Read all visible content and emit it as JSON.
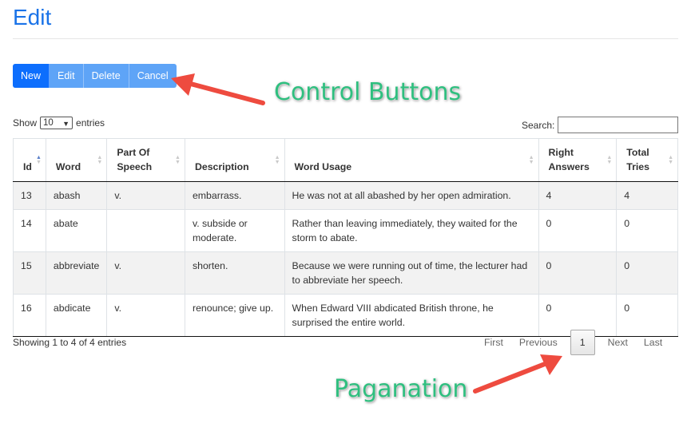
{
  "page": {
    "title": "Edit"
  },
  "toolbar": {
    "new_label": "New",
    "edit_label": "Edit",
    "delete_label": "Delete",
    "cancel_label": "Cancel"
  },
  "length": {
    "prefix": "Show",
    "value": "10",
    "suffix": "entries"
  },
  "search": {
    "label": "Search:",
    "value": ""
  },
  "table": {
    "columns": [
      {
        "label": "Id"
      },
      {
        "label": "Word"
      },
      {
        "label": "Part Of Speech"
      },
      {
        "label": "Description"
      },
      {
        "label": "Word Usage"
      },
      {
        "label": "Right Answers"
      },
      {
        "label": "Total Tries"
      }
    ],
    "rows": [
      [
        "13",
        "abash",
        "v.",
        "embarrass.",
        "He was not at all abashed by her open admiration.",
        "4",
        "4"
      ],
      [
        "14",
        "abate",
        "",
        "v. subside or moderate.",
        "Rather than leaving immediately, they waited for the storm to abate.",
        "0",
        "0"
      ],
      [
        "15",
        "abbreviate",
        "v.",
        "shorten.",
        "Because we were running out of time, the lecturer had to abbreviate her speech.",
        "0",
        "0"
      ],
      [
        "16",
        "abdicate",
        "v.",
        "renounce; give up.",
        "When Edward VIII abdicated British throne, he surprised the entire world.",
        "0",
        "0"
      ]
    ]
  },
  "info": {
    "text": "Showing 1 to 4 of 4 entries"
  },
  "pagination": {
    "first": "First",
    "previous": "Previous",
    "current": "1",
    "next": "Next",
    "last": "Last"
  },
  "annotations": {
    "control_buttons": "Control Buttons",
    "pagination": "Paganation",
    "arrow_color": "#ee4b3f",
    "text_color": "#2fbf7f"
  },
  "colors": {
    "title": "#1a73e8",
    "primary_button": "#0d6efd",
    "light_button": "#5ea4f7"
  }
}
